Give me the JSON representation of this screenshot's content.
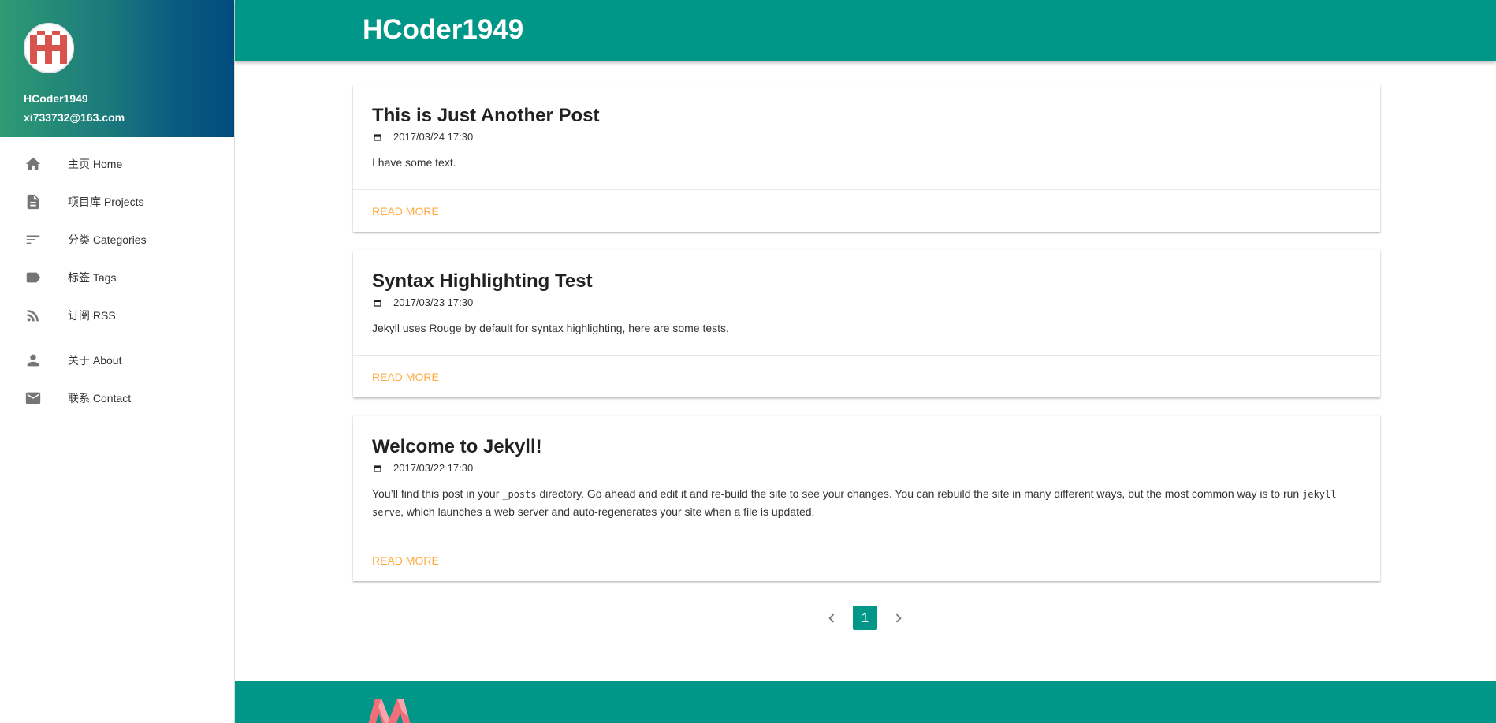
{
  "sidebar": {
    "name": "HCoder1949",
    "email": "xi733732@163.com",
    "nav_primary": [
      {
        "label": "主页 Home",
        "icon": "home-icon"
      },
      {
        "label": "项目库 Projects",
        "icon": "document-icon"
      },
      {
        "label": "分类 Categories",
        "icon": "sort-icon"
      },
      {
        "label": "标签 Tags",
        "icon": "label-icon"
      },
      {
        "label": "订阅 RSS",
        "icon": "rss-icon"
      }
    ],
    "nav_secondary": [
      {
        "label": "关于 About",
        "icon": "person-icon"
      },
      {
        "label": "联系 Contact",
        "icon": "mail-icon"
      }
    ]
  },
  "header": {
    "title": "HCoder1949"
  },
  "posts": [
    {
      "title": "This is Just Another Post",
      "date": "2017/03/24 17:30",
      "excerpt": "I have some text.",
      "action": "READ MORE"
    },
    {
      "title": "Syntax Highlighting Test",
      "date": "2017/03/23 17:30",
      "excerpt": "Jekyll uses Rouge by default for syntax highlighting, here are some tests.",
      "action": "READ MORE"
    },
    {
      "title": "Welcome to Jekyll!",
      "date": "2017/03/22 17:30",
      "excerpt_parts": [
        "You’ll find this post in your ",
        "_posts",
        " directory. Go ahead and edit it and re-build the site to see your changes. You can rebuild the site in many different ways, but the most common way is to run ",
        "jekyll serve",
        ", which launches a web server and auto-regenerates your site when a file is updated."
      ],
      "action": "READ MORE"
    }
  ],
  "pagination": {
    "current_page": "1",
    "prev_icon": "chevron-left-icon",
    "next_icon": "chevron-right-icon"
  },
  "colors": {
    "primary": "#009688",
    "accent": "#ffab40",
    "sidebar_gradient_start": "#2e9b74",
    "sidebar_gradient_end": "#004c7f"
  }
}
